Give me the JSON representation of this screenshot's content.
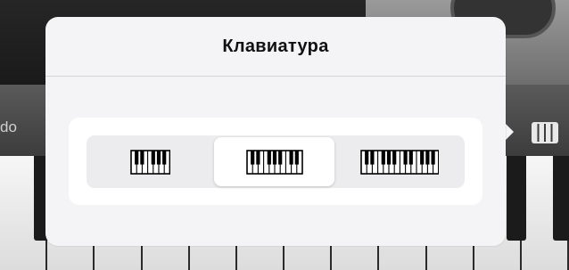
{
  "background": {
    "instrument_label": "do"
  },
  "popover": {
    "title": "Клавиатура",
    "size_options": [
      {
        "icon": "small-keyboard-icon",
        "keys": 7,
        "selected": false
      },
      {
        "icon": "medium-keyboard-icon",
        "keys": 10,
        "selected": true
      },
      {
        "icon": "large-keyboard-icon",
        "keys": 14,
        "selected": false
      }
    ]
  },
  "colors": {
    "popover_bg": "#f4f4f6",
    "segment_bg": "#ececee",
    "selected_segment": "#ffffff",
    "key_outline": "#000000"
  }
}
